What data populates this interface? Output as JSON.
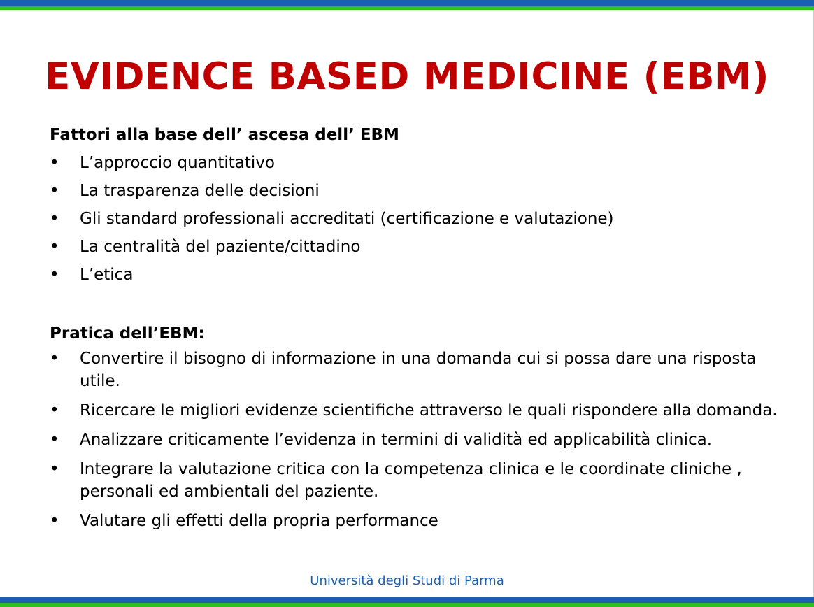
{
  "slide": {
    "title": "EVIDENCE BASED MEDICINE (EBM)",
    "bullet_symbol": "•",
    "section1": {
      "heading": "Fattori alla base dell’ ascesa dell’ EBM",
      "items": [
        "L’approccio quantitativo",
        "La trasparenza delle decisioni",
        "Gli standard professionali accreditati (certificazione e valutazione)",
        "La centralità del paziente/cittadino",
        "L’etica"
      ]
    },
    "section2": {
      "heading": "Pratica dell’EBM:",
      "items": [
        "Convertire il bisogno di informazione in una domanda cui si possa dare una risposta utile.",
        "Ricercare le migliori evidenze scientifiche attraverso le quali rispondere alla domanda.",
        "Analizzare criticamente l’evidenza in termini di validità ed applicabilità clinica.",
        "Integrare la valutazione critica con la competenza clinica e le coordinate cliniche , personali ed ambientali del paziente.",
        "Valutare gli effetti della propria performance"
      ]
    },
    "footer": "Università degli Studi di Parma"
  },
  "colors": {
    "title": "#c00000",
    "band_blue": "#1a5fb0",
    "band_green": "#2ec020",
    "footer": "#1a5fb0"
  }
}
